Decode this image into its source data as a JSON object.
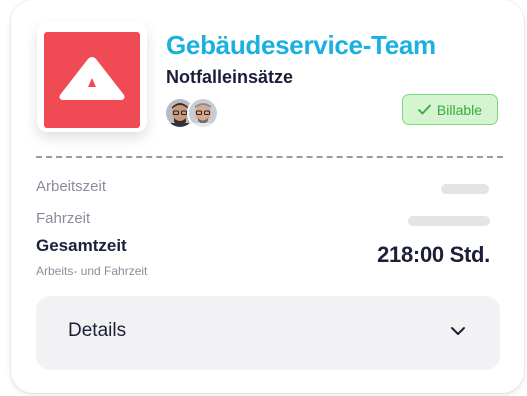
{
  "header": {
    "title": "Gebäudeservice-Team",
    "subtitle": "Notfalleinsätze",
    "logo_icon": "triangle-logo-icon",
    "logo_color": "#f04b55",
    "title_color": "#1ab0e0"
  },
  "avatars": [
    {
      "icon": "avatar-person-glasses-1"
    },
    {
      "icon": "avatar-person-glasses-2"
    }
  ],
  "billable": {
    "label": "Billable",
    "icon": "check-icon",
    "color": "#3aa83a",
    "background": "#d5f5d0"
  },
  "rows": {
    "work_time_label": "Arbeitszeit",
    "travel_time_label": "Fahrzeit"
  },
  "total": {
    "label": "Gesamtzeit",
    "sublabel": "Arbeits- und Fahrzeit",
    "value": "218:00 Std."
  },
  "details": {
    "label": "Details",
    "icon": "chevron-down-icon"
  }
}
